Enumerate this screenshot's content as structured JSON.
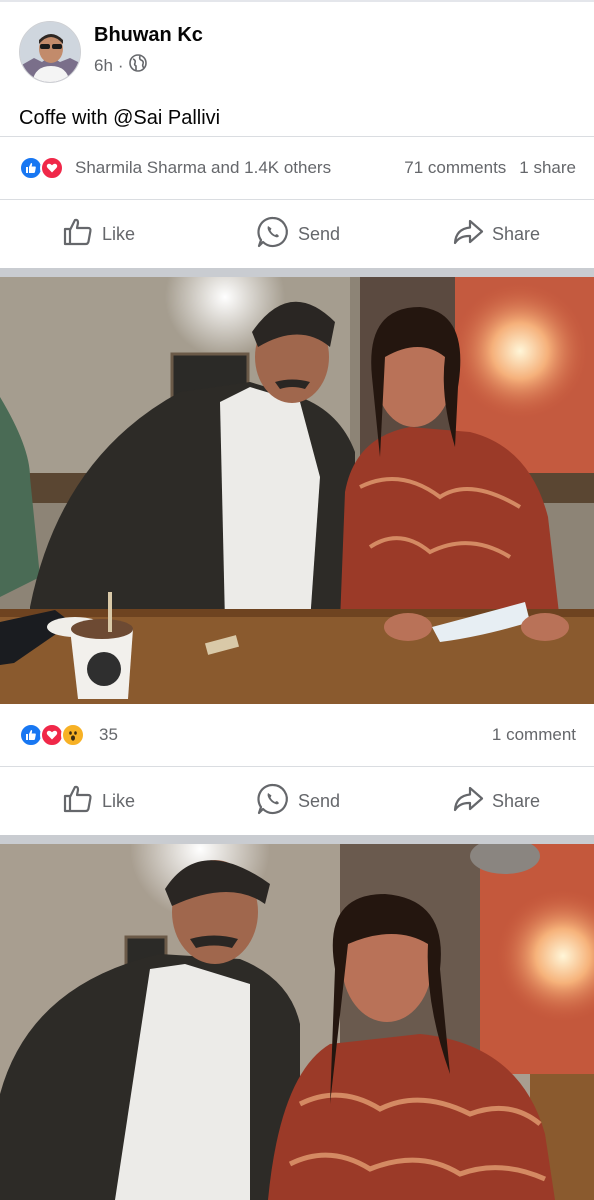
{
  "post": {
    "author": "Bhuwan Kc",
    "time": "6h",
    "separator": "·",
    "caption": "Coffe with @Sai Pallivi",
    "reactions_text": "Sharmila Sharma and 1.4K others",
    "comments": "71 comments",
    "shares": "1 share"
  },
  "actions": {
    "like": "Like",
    "send": "Send",
    "share": "Share"
  },
  "photo1": {
    "reactions_count": "35",
    "comments": "1 comment"
  },
  "colors": {
    "like_blue": "#1877f2",
    "love_red": "#f02849",
    "wow_yellow": "#f7b125",
    "muted_text": "#65676b",
    "separator_gray": "#c9ccd1"
  }
}
